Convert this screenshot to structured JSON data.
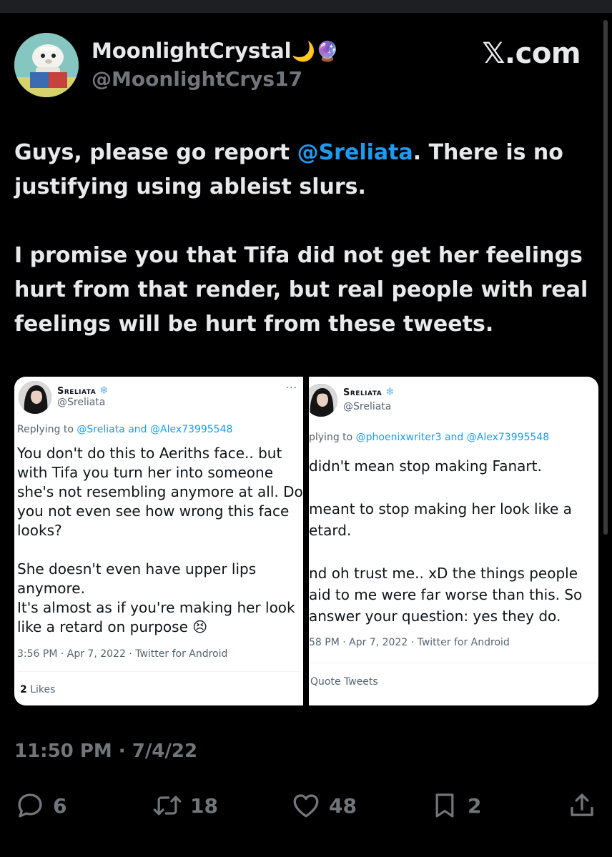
{
  "author": {
    "display_name": "MoonlightCrystal",
    "name_emojis": "🌙🔮",
    "handle": "@MoonlightCrys17"
  },
  "site_label": "𝕏.com",
  "tweet": {
    "line1_pre": "Guys, please go report ",
    "line1_mention": "@Sreliata",
    "line1_post": ". There is no",
    "line2": "justifying using ableist slurs.",
    "line3": "I promise you that Tifa did not get her feelings",
    "line4": "hurt from that render, but real people with real",
    "line5": "feelings will be hurt from these tweets."
  },
  "embedded_left": {
    "name": "Sreliata",
    "snow": "❄",
    "handle": "@Sreliata",
    "more": "···",
    "reply_prefix": "Replying to ",
    "reply_to": "@Sreliata and @Alex73995548",
    "body": [
      "You don't do this to Aeriths face.. but",
      "with Tifa you turn her into someone",
      "she's not resembling anymore at all. Do",
      "you not even see how wrong this face",
      "looks?",
      "",
      "She doesn't even have upper lips",
      "anymore.",
      "It's almost as if you're making her look",
      "like a retard on purpose 😣"
    ],
    "meta": "3:56 PM · Apr 7, 2022 · Twitter for Android",
    "likes_count": "2",
    "likes_label": " Likes"
  },
  "embedded_right": {
    "name": "Sreliata",
    "snow": "❄",
    "handle": "@Sreliata",
    "reply_prefix": "plying to ",
    "reply_to": "@phoenixwriter3 and @Alex73995548",
    "body": [
      "didn't mean stop making Fanart.",
      "",
      "meant to stop making her look like a",
      "etard.",
      "",
      "nd oh trust me.. xD the things people",
      "aid to me were far worse than this. So",
      "answer your question: yes they do."
    ],
    "meta": "58 PM · Apr 7, 2022 · Twitter for Android",
    "quote_label": "Quote Tweets"
  },
  "timestamp": "11:50 PM · 7/4/22",
  "actions": {
    "replies": "6",
    "retweets": "18",
    "likes": "48",
    "bookmarks": "2"
  },
  "colors": {
    "background": "#000000",
    "text": "#e7e9ea",
    "muted": "#71767b",
    "link": "#1d9bf0"
  }
}
